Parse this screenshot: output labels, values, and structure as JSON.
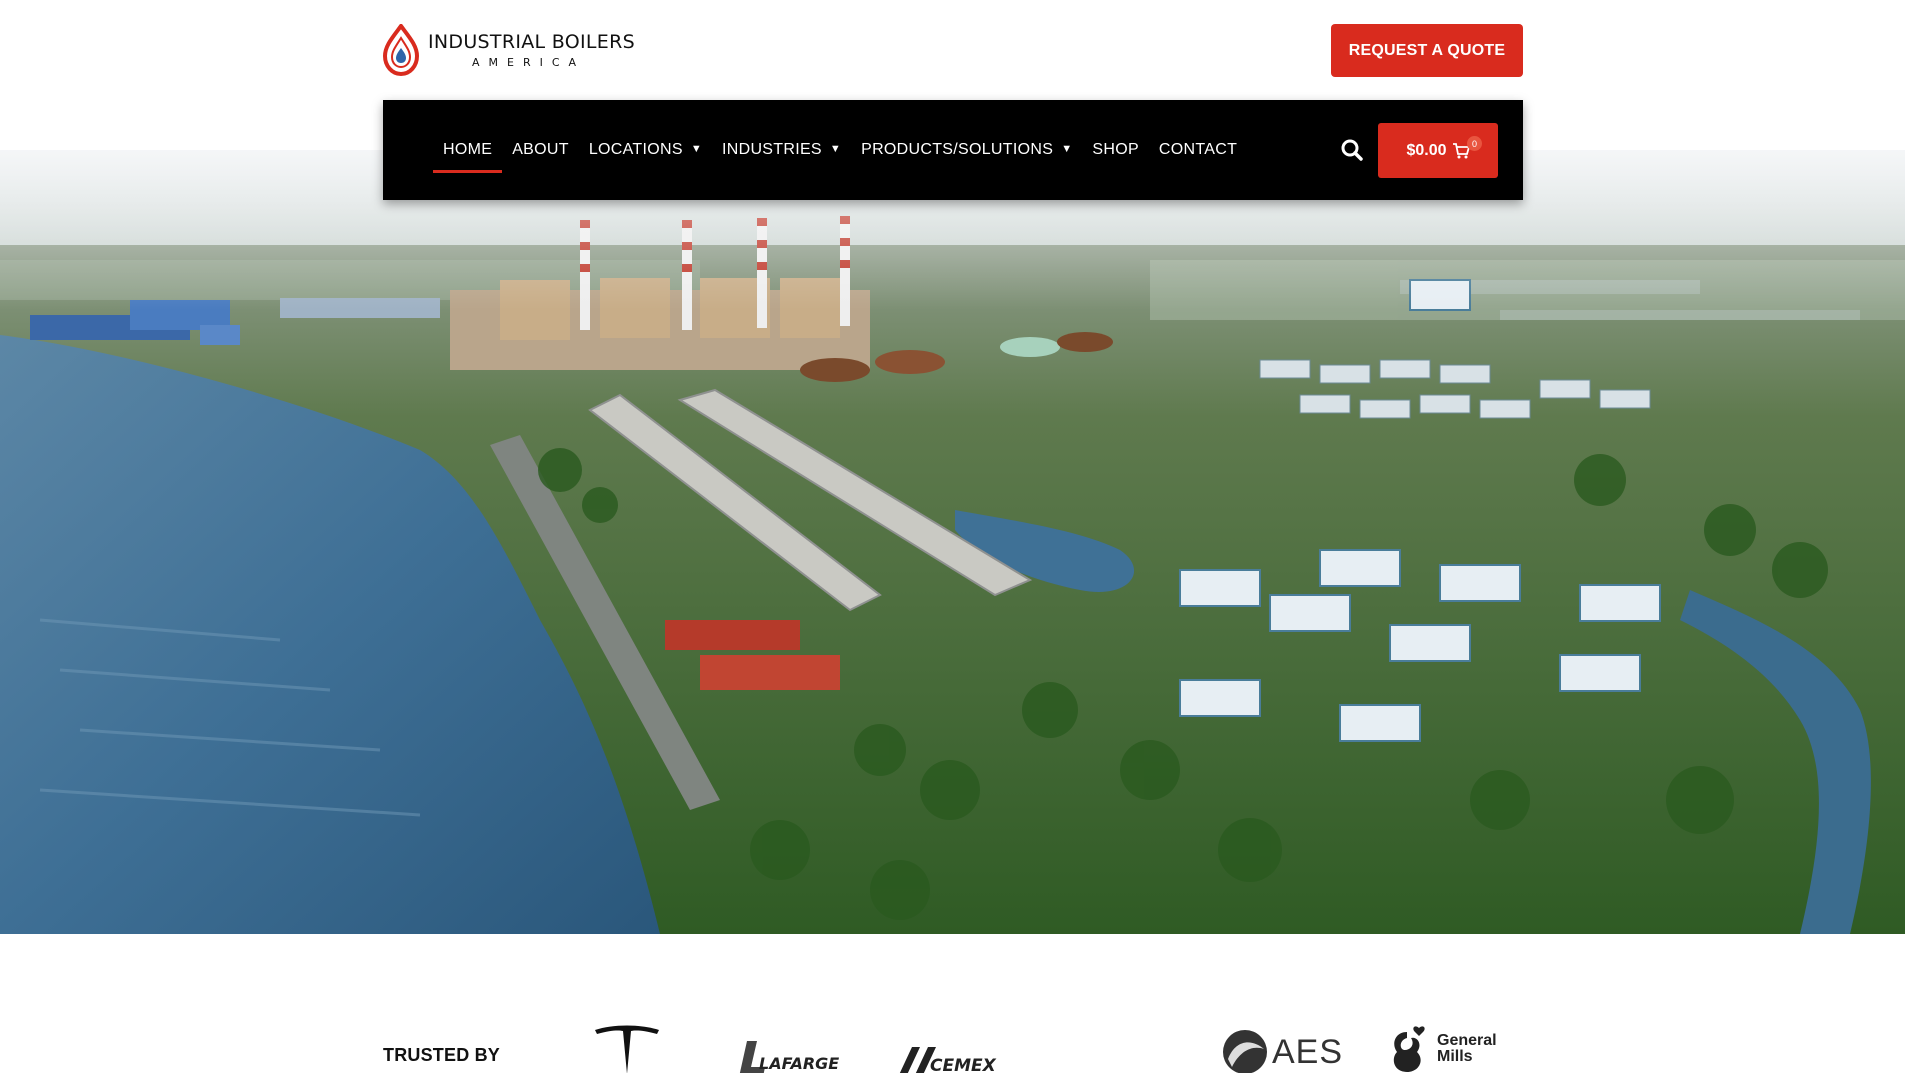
{
  "brand": {
    "title": "INDUSTRIAL BOILERS",
    "subtitle": "AMERICA"
  },
  "header": {
    "quote_label": "REQUEST A QUOTE"
  },
  "nav": {
    "items": [
      {
        "label": "HOME",
        "active": true,
        "dropdown": false
      },
      {
        "label": "ABOUT",
        "active": false,
        "dropdown": false
      },
      {
        "label": "LOCATIONS",
        "active": false,
        "dropdown": true
      },
      {
        "label": "INDUSTRIES",
        "active": false,
        "dropdown": true
      },
      {
        "label": "PRODUCTS/SOLUTIONS",
        "active": false,
        "dropdown": true
      },
      {
        "label": "SHOP",
        "active": false,
        "dropdown": false
      },
      {
        "label": "CONTACT",
        "active": false,
        "dropdown": false
      }
    ],
    "search_icon": "search-icon",
    "cart_total": "$0.00",
    "cart_count": "0"
  },
  "trusted": {
    "label": "TRUSTED BY",
    "logos": [
      "LAFARGE",
      "CEMEX",
      "AES",
      "General",
      "Mills"
    ]
  },
  "colors": {
    "accent": "#d92b1e",
    "nav_bg": "#000000",
    "water": "#3e6f95"
  }
}
